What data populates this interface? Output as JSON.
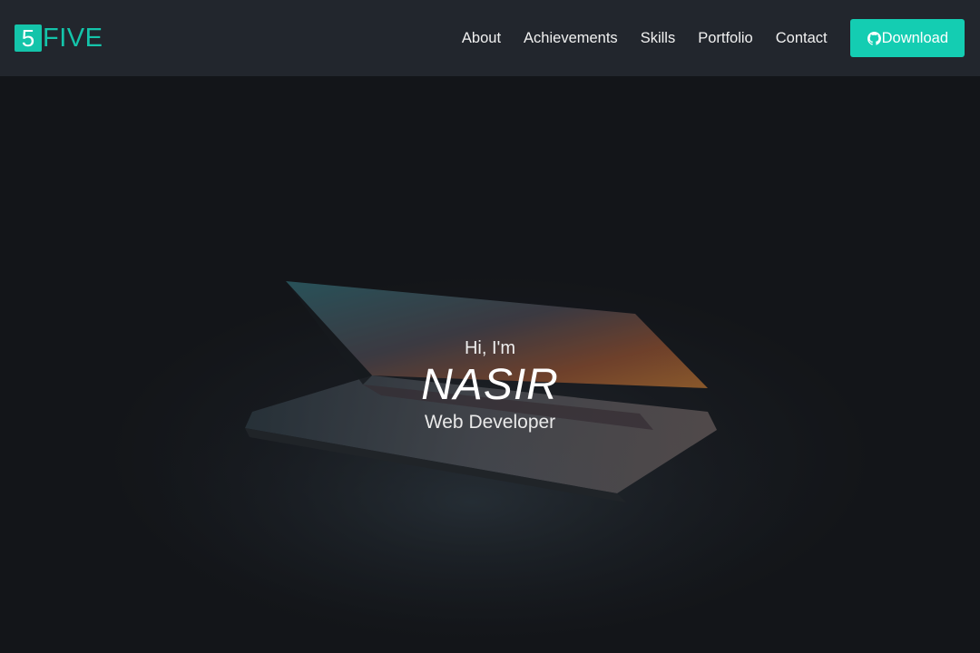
{
  "brand": {
    "mark": "5",
    "text": "FIVE"
  },
  "nav": {
    "links": [
      "About",
      "Achievements",
      "Skills",
      "Portfolio",
      "Contact"
    ],
    "download_label": "Download"
  },
  "hero": {
    "greeting": "Hi, I'm",
    "name": "NASIR",
    "role": "Web Developer"
  },
  "colors": {
    "accent": "#14cdb2",
    "navbar_bg": "#22262d",
    "page_bg": "#181b20"
  },
  "icons": {
    "download": "github-icon",
    "background": "laptop-photo"
  }
}
